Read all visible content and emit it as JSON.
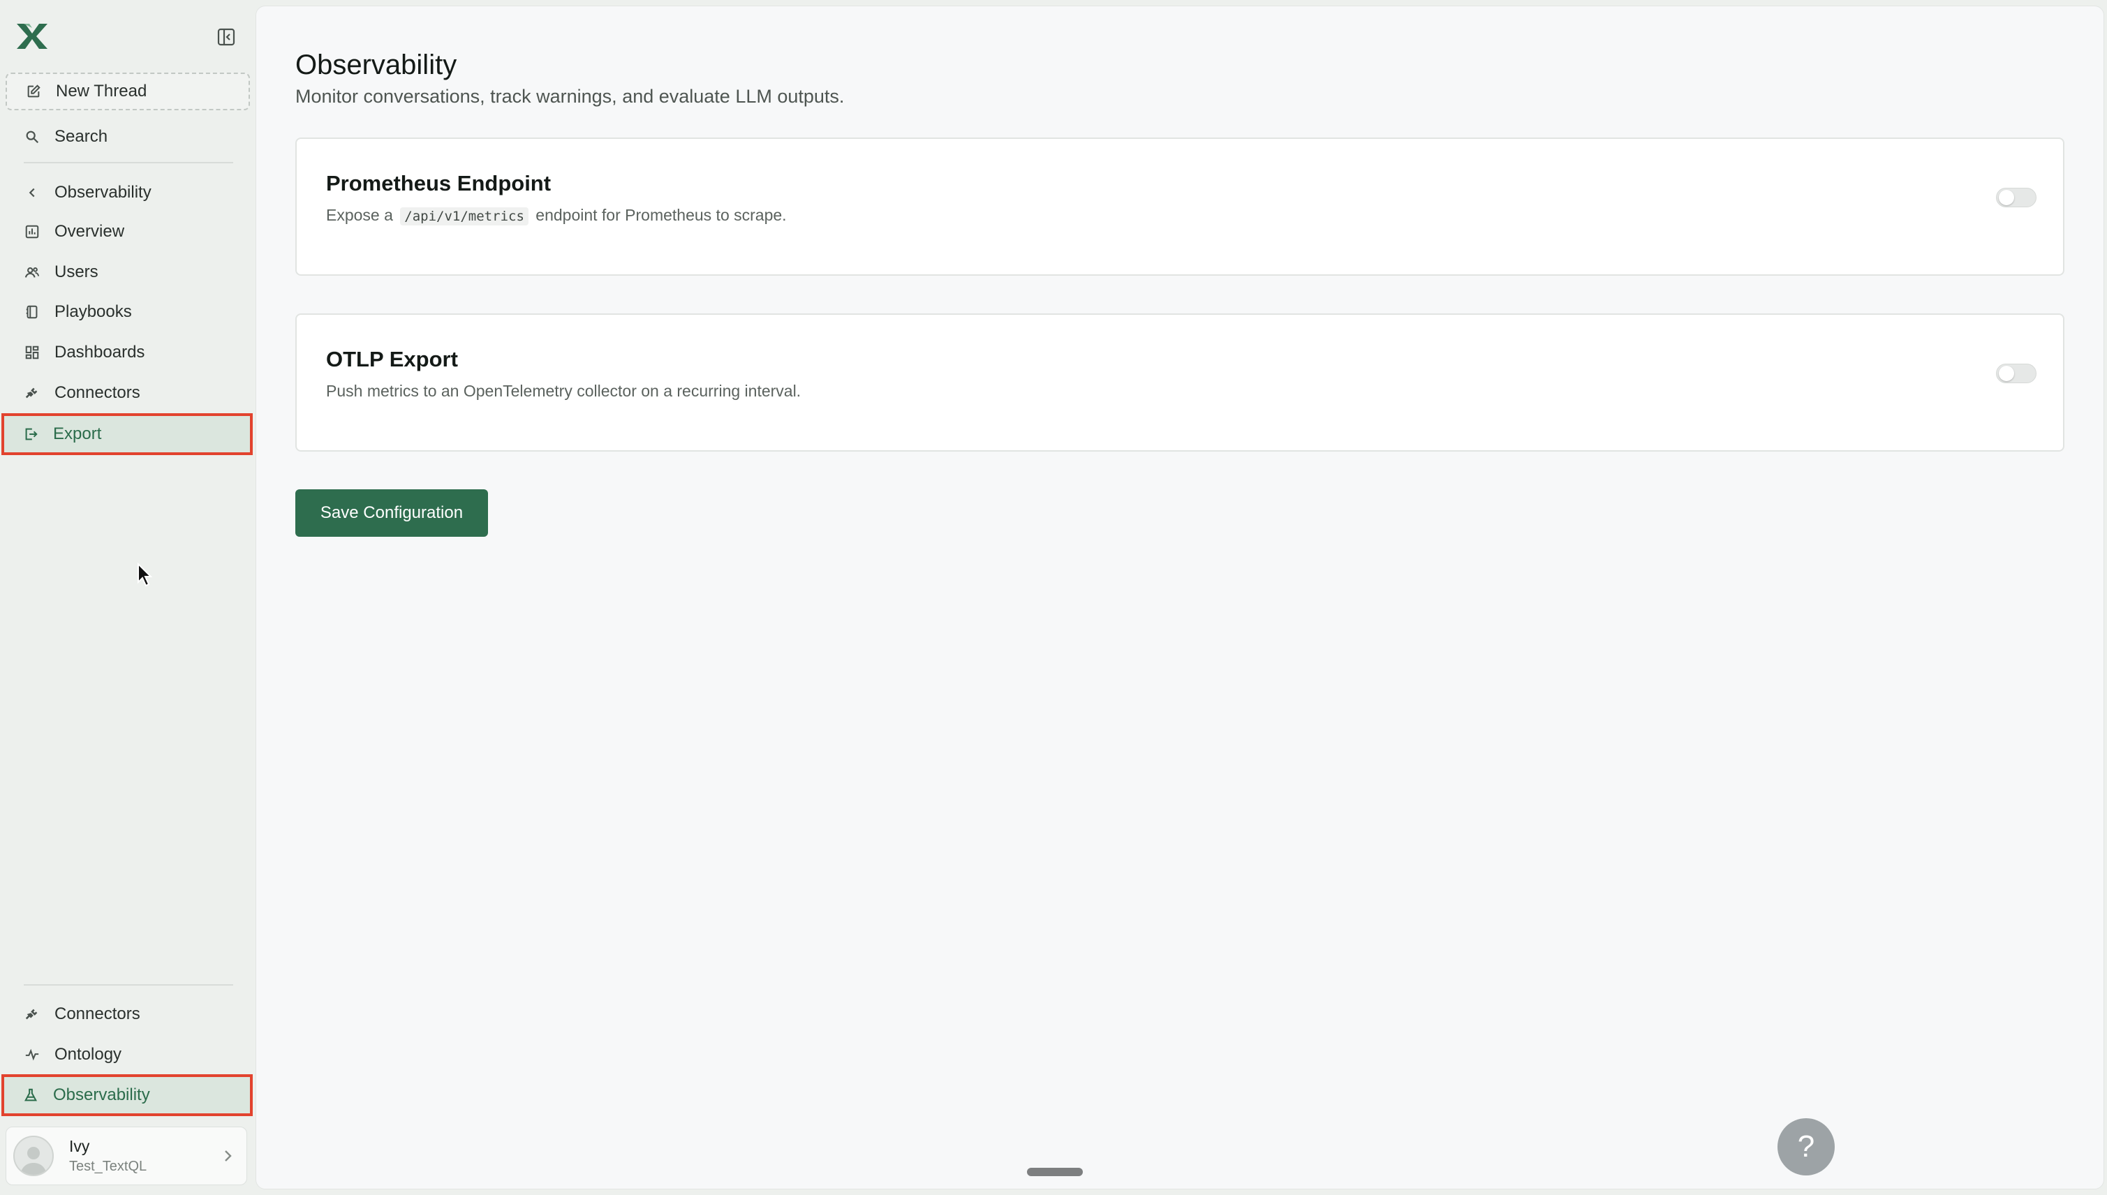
{
  "sidebar": {
    "new_thread": "New Thread",
    "search": "Search",
    "back_label": "Observability",
    "items": [
      {
        "label": "Overview",
        "icon": "chart-bar-icon"
      },
      {
        "label": "Users",
        "icon": "users-icon"
      },
      {
        "label": "Playbooks",
        "icon": "book-icon"
      },
      {
        "label": "Dashboards",
        "icon": "grid-icon"
      },
      {
        "label": "Connectors",
        "icon": "plug-icon"
      },
      {
        "label": "Export",
        "icon": "export-icon",
        "active": true
      }
    ],
    "bottom_items": [
      {
        "label": "Connectors",
        "icon": "plug-icon"
      },
      {
        "label": "Ontology",
        "icon": "ontology-icon"
      },
      {
        "label": "Observability",
        "icon": "flask-icon",
        "active": true
      }
    ],
    "user": {
      "name": "Ivy",
      "org": "Test_TextQL"
    }
  },
  "page": {
    "title": "Observability",
    "subtitle": "Monitor conversations, track warnings, and evaluate LLM outputs."
  },
  "cards": [
    {
      "title": "Prometheus Endpoint",
      "desc_prefix": "Expose a",
      "desc_code": "/api/v1/metrics",
      "desc_suffix": "endpoint for Prometheus to scrape.",
      "enabled": false
    },
    {
      "title": "OTLP Export",
      "desc": "Push metrics to an OpenTelemetry collector on a recurring interval.",
      "enabled": false
    }
  ],
  "actions": {
    "save_label": "Save Configuration"
  },
  "help": {
    "label": "?"
  },
  "colors": {
    "accent": "#2e6d4e",
    "highlight_outline": "#e2432e",
    "active_bg": "#dbe6de"
  }
}
